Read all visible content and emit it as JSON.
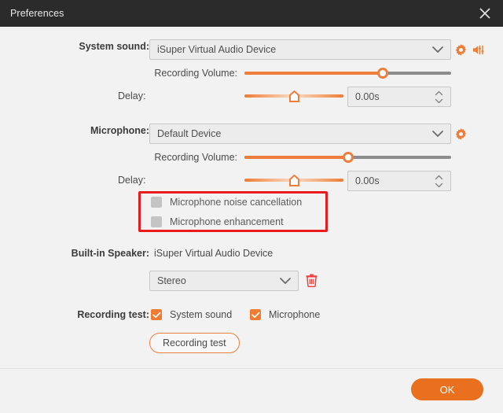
{
  "window": {
    "title": "Preferences",
    "close_icon": "close-icon"
  },
  "colors": {
    "accent": "#ef7e3c",
    "accent_button": "#e8701e",
    "titlebar": "#2b2b2b",
    "body": "#f2f2f2",
    "annotation": "#e81c1c",
    "checkbox_on": "#f07c33",
    "checkbox_off": "#c4c4c4",
    "trash": "#ee3b3b"
  },
  "system_sound": {
    "label": "System sound:",
    "device": "iSuper Virtual Audio Device",
    "gear_icon": "gear-icon",
    "speaker_icon": "speaker-mixer-icon",
    "volume_label": "Recording Volume:",
    "volume_percent": 67,
    "delay_label": "Delay:",
    "delay_value": "0.00s",
    "delay_percent": 50
  },
  "microphone": {
    "label": "Microphone:",
    "device": "Default Device",
    "gear_icon": "gear-icon",
    "volume_label": "Recording Volume:",
    "volume_percent": 50,
    "delay_label": "Delay:",
    "delay_value": "0.00s",
    "delay_percent": 50,
    "noise_cancellation_label": "Microphone noise cancellation",
    "noise_cancellation_checked": false,
    "enhancement_label": "Microphone enhancement",
    "enhancement_checked": false
  },
  "builtin_speaker": {
    "label": "Built-in Speaker:",
    "device": "iSuper Virtual Audio Device",
    "channel": "Stereo",
    "delete_icon": "trash-icon"
  },
  "recording_test": {
    "label": "Recording test:",
    "system_sound_label": "System sound",
    "system_sound_checked": true,
    "microphone_label": "Microphone",
    "microphone_checked": true,
    "button_label": "Recording test"
  },
  "footer": {
    "ok_label": "OK"
  }
}
